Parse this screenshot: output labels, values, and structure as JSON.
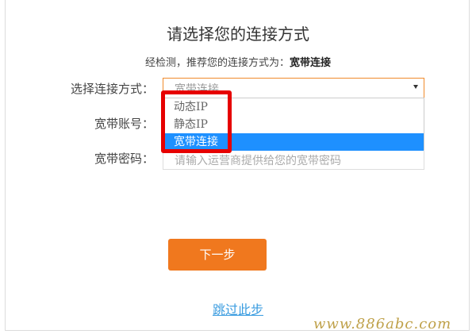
{
  "page": {
    "title": "请选择您的连接方式",
    "detect_prefix": "经检测，推荐您的连接方式为：",
    "detect_value": "宽带连接"
  },
  "form": {
    "conn_label": "选择连接方式：",
    "conn_value": "宽带连接",
    "account_label": "宽带账号：",
    "password_label": "宽带密码：",
    "password_placeholder": "请输入运营商提供给您的宽带密码"
  },
  "dropdown": {
    "options": [
      "动态IP",
      "静态IP",
      "宽带连接"
    ],
    "selected": "宽带连接"
  },
  "actions": {
    "next_label": "下一步",
    "skip_label": "跳过此步"
  },
  "watermark": "www.886abc.com",
  "colors": {
    "accent": "#f0781e",
    "highlight": "#e60000",
    "selected": "#1e90ff",
    "link": "#3a9ce0"
  },
  "icons": [
    "chevron-down-icon"
  ]
}
